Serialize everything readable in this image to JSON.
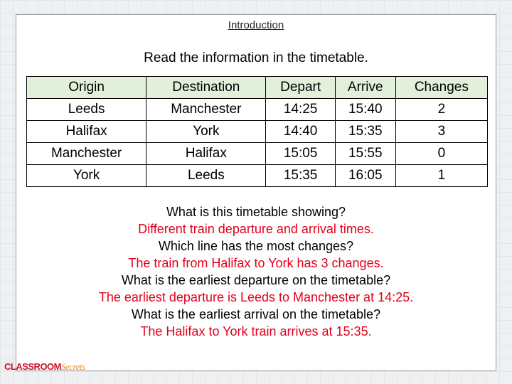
{
  "title": "Introduction",
  "instruction": "Read the information in the timetable.",
  "table": {
    "headers": [
      "Origin",
      "Destination",
      "Depart",
      "Arrive",
      "Changes"
    ],
    "rows": [
      [
        "Leeds",
        "Manchester",
        "14:25",
        "15:40",
        "2"
      ],
      [
        "Halifax",
        "York",
        "14:40",
        "15:35",
        "3"
      ],
      [
        "Manchester",
        "Halifax",
        "15:05",
        "15:55",
        "0"
      ],
      [
        "York",
        "Leeds",
        "15:35",
        "16:05",
        "1"
      ]
    ]
  },
  "qa": [
    {
      "q": "What is this timetable showing?",
      "a": "Different train departure and arrival times."
    },
    {
      "q": "Which line has the most changes?",
      "a": "The train from Halifax to York has 3 changes."
    },
    {
      "q": "What is the earliest departure on the timetable?",
      "a": "The earliest departure is Leeds to Manchester at 14:25."
    },
    {
      "q": "What is the earliest arrival on the timetable?",
      "a": "The Halifax to York train arrives at 15:35."
    }
  ],
  "logo": {
    "part1": "CLASSROOM",
    "part2": "Secrets"
  },
  "colors": {
    "header_bg": "#e2efda",
    "answer": "#e0001b"
  }
}
